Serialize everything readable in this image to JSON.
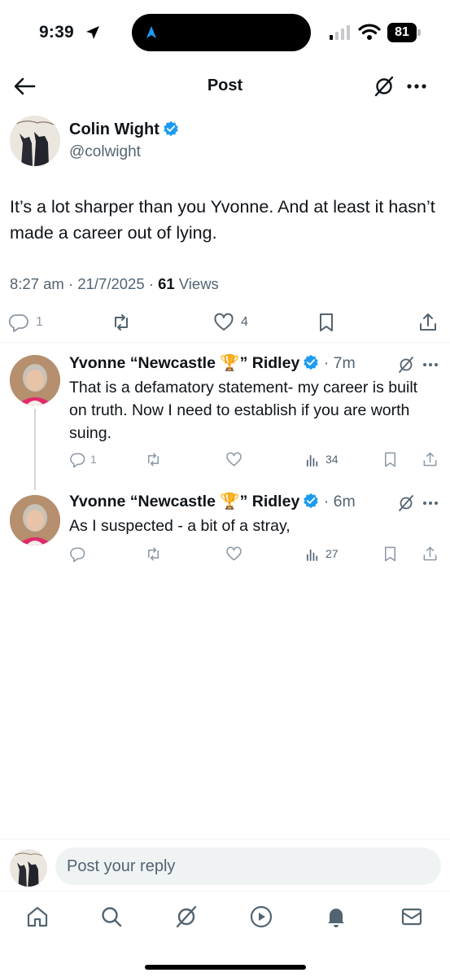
{
  "status_bar": {
    "time": "9:39",
    "battery": "81"
  },
  "header": {
    "title": "Post"
  },
  "post": {
    "author_name": "Colin Wight",
    "author_handle": "@colwight",
    "text": "It’s a lot sharper than you Yvonne. And at least it hasn’t made a career out of lying.",
    "time": "8:27 am",
    "date": "21/7/2025",
    "views_count": "61",
    "views_label": "Views",
    "reply_count": "1",
    "like_count": "4"
  },
  "replies": [
    {
      "name": "Yvonne “Newcastle 🏆” Ridley",
      "time": "7m",
      "text": "That is a defamatory statement- my career is built on truth. Now I need to establish if you are worth suing.",
      "reply_count": "1",
      "view_count": "34"
    },
    {
      "name": "Yvonne “Newcastle 🏆” Ridley",
      "time": "6m",
      "text": "As I suspected - a bit of a stray,",
      "view_count": "27"
    }
  ],
  "composer": {
    "placeholder": "Post your reply"
  },
  "colors": {
    "accent": "#1d9bf0",
    "text": "#0f1419",
    "muted": "#536471",
    "verified": "#1d9bf0"
  },
  "icons": [
    "location-arrow-icon",
    "navigation-icon",
    "signal-icon",
    "wifi-icon",
    "battery-icon",
    "back-arrow-icon",
    "grok-icon",
    "more-icon",
    "reply-icon",
    "repost-icon",
    "like-icon",
    "bookmark-icon",
    "share-icon",
    "views-icon",
    "home-icon",
    "search-icon",
    "play-icon",
    "bell-icon",
    "mail-icon"
  ]
}
